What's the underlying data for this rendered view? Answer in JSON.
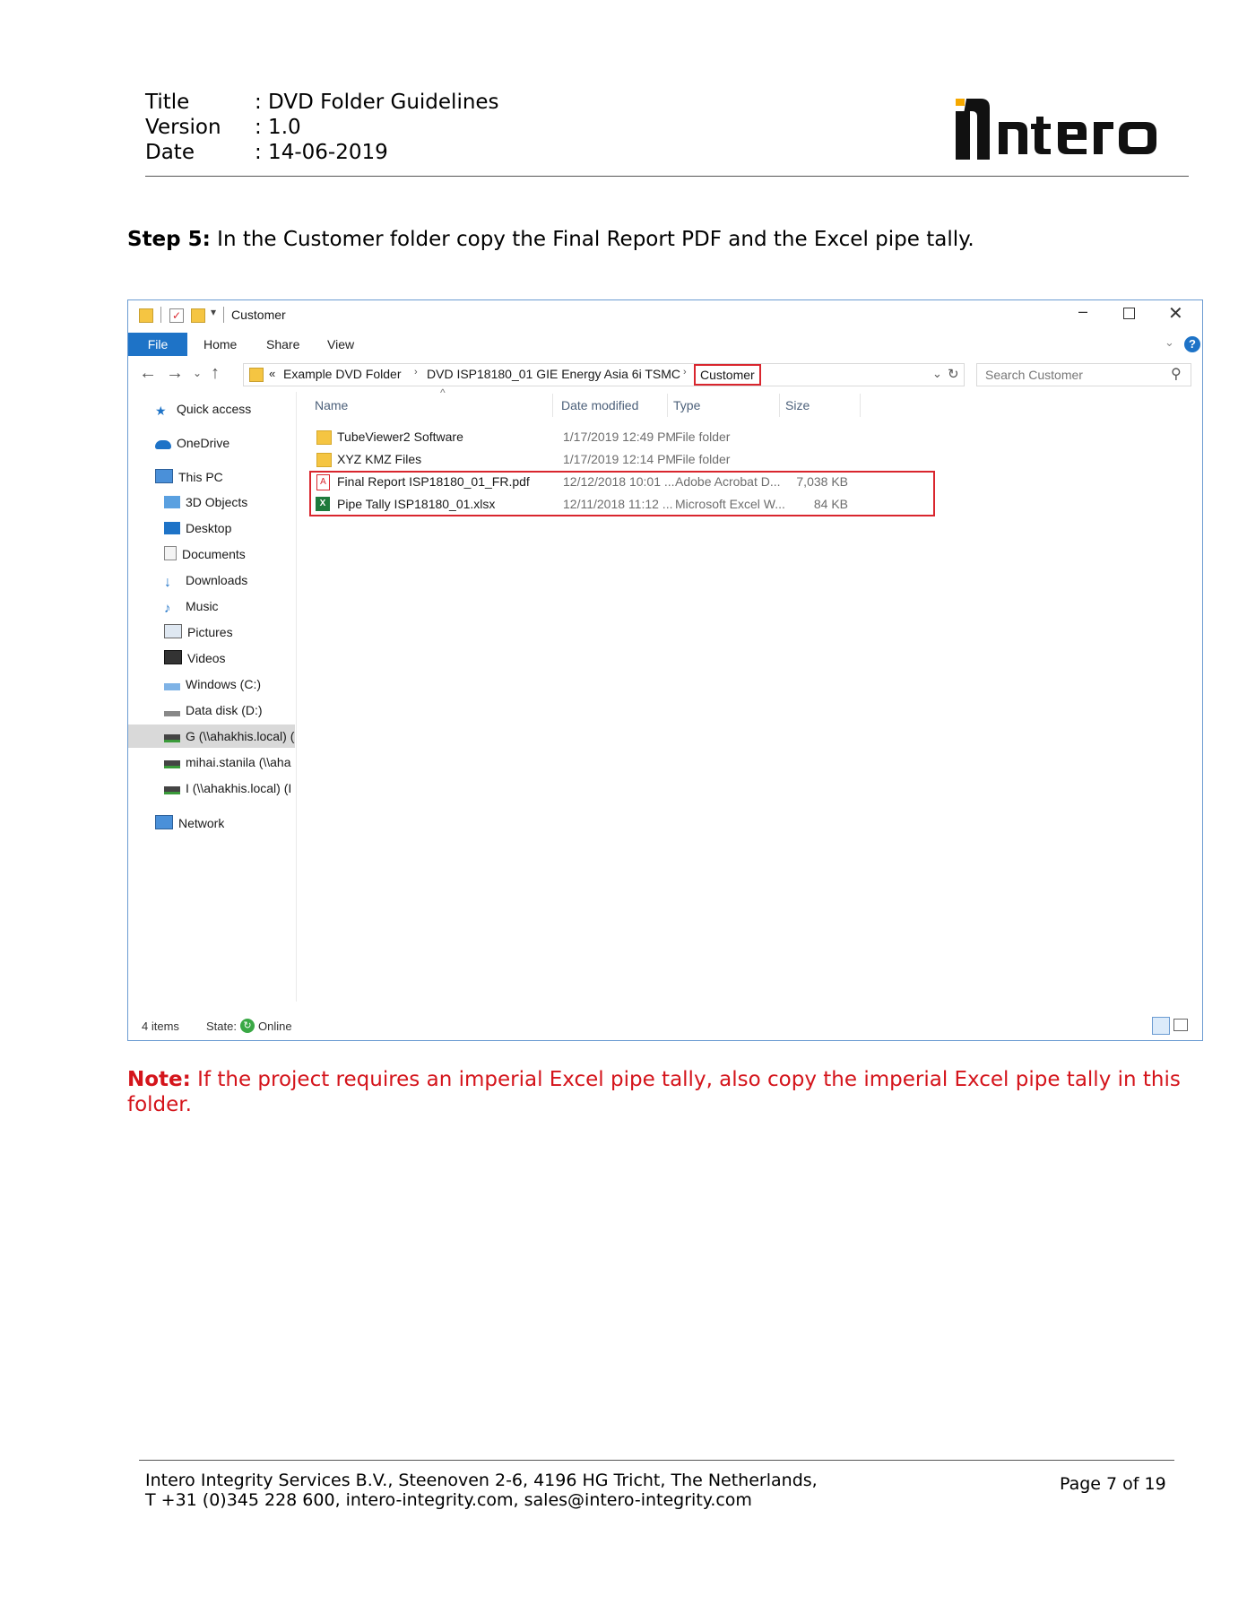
{
  "header": {
    "rows": [
      {
        "label": "Title",
        "value": ": DVD Folder Guidelines"
      },
      {
        "label": "Version",
        "value": ": 1.0"
      },
      {
        "label": "Date",
        "value": ": 14-06-2019"
      }
    ],
    "logo_text": "intero"
  },
  "step": {
    "bold": "Step 5:",
    "text": " In the Customer folder copy the Final Report PDF and the Excel pipe tally."
  },
  "explorer": {
    "title": "Customer",
    "tabs": [
      "File",
      "Home",
      "Share",
      "View"
    ],
    "breadcrumb": {
      "prefix": "«",
      "parts": [
        "Example DVD Folder",
        "DVD ISP18180_01 GIE Energy Asia 6i TSMC",
        "Customer"
      ]
    },
    "search_placeholder": "Search Customer",
    "sidebar": [
      {
        "label": "Quick access",
        "icon": "star-icon"
      },
      {
        "label": "OneDrive",
        "icon": "cloud-icon"
      },
      {
        "label": "This PC",
        "icon": "computer-icon"
      },
      {
        "label": "3D Objects",
        "icon": "cube-icon"
      },
      {
        "label": "Desktop",
        "icon": "desktop-icon"
      },
      {
        "label": "Documents",
        "icon": "document-icon"
      },
      {
        "label": "Downloads",
        "icon": "download-icon"
      },
      {
        "label": "Music",
        "icon": "music-icon"
      },
      {
        "label": "Pictures",
        "icon": "picture-icon"
      },
      {
        "label": "Videos",
        "icon": "video-icon"
      },
      {
        "label": "Windows (C:)",
        "icon": "drive-icon"
      },
      {
        "label": "Data disk (D:)",
        "icon": "drive-icon"
      },
      {
        "label": "G (\\\\ahakhis.local) (",
        "icon": "network-drive-icon"
      },
      {
        "label": "mihai.stanila (\\\\aha",
        "icon": "network-drive-icon"
      },
      {
        "label": "I (\\\\ahakhis.local) (I",
        "icon": "network-drive-icon"
      },
      {
        "label": "Network",
        "icon": "network-icon"
      }
    ],
    "columns": {
      "name": "Name",
      "date": "Date modified",
      "type": "Type",
      "size": "Size"
    },
    "files": [
      {
        "name": "TubeViewer2 Software",
        "date": "1/17/2019 12:49 PM",
        "type": "File folder",
        "size": "",
        "icon": "folder-icon"
      },
      {
        "name": "XYZ KMZ Files",
        "date": "1/17/2019 12:14 PM",
        "type": "File folder",
        "size": "",
        "icon": "folder-icon"
      },
      {
        "name": "Final Report ISP18180_01_FR.pdf",
        "date": "12/12/2018 10:01 ...",
        "type": "Adobe Acrobat D...",
        "size": "7,038 KB",
        "icon": "pdf-icon"
      },
      {
        "name": "Pipe Tally ISP18180_01.xlsx",
        "date": "12/11/2018 11:12 ...",
        "type": "Microsoft Excel W...",
        "size": "84 KB",
        "icon": "excel-icon"
      }
    ],
    "status": {
      "items": "4 items",
      "state_label": "State:",
      "state_value": "Online"
    },
    "colors": {
      "accent": "#1e73c7",
      "highlight": "#d9262e"
    }
  },
  "note": {
    "bold": "Note:",
    "text": " If the project requires an imperial Excel pipe tally, also copy the imperial Excel pipe tally in this folder."
  },
  "footer": {
    "line1": "Intero Integrity Services B.V., Steenoven 2-6, 4196 HG Tricht, The Netherlands,",
    "line2": "T +31 (0)345 228 600, intero-integrity.com, sales@intero-integrity.com",
    "page": "Page 7 of 19"
  }
}
